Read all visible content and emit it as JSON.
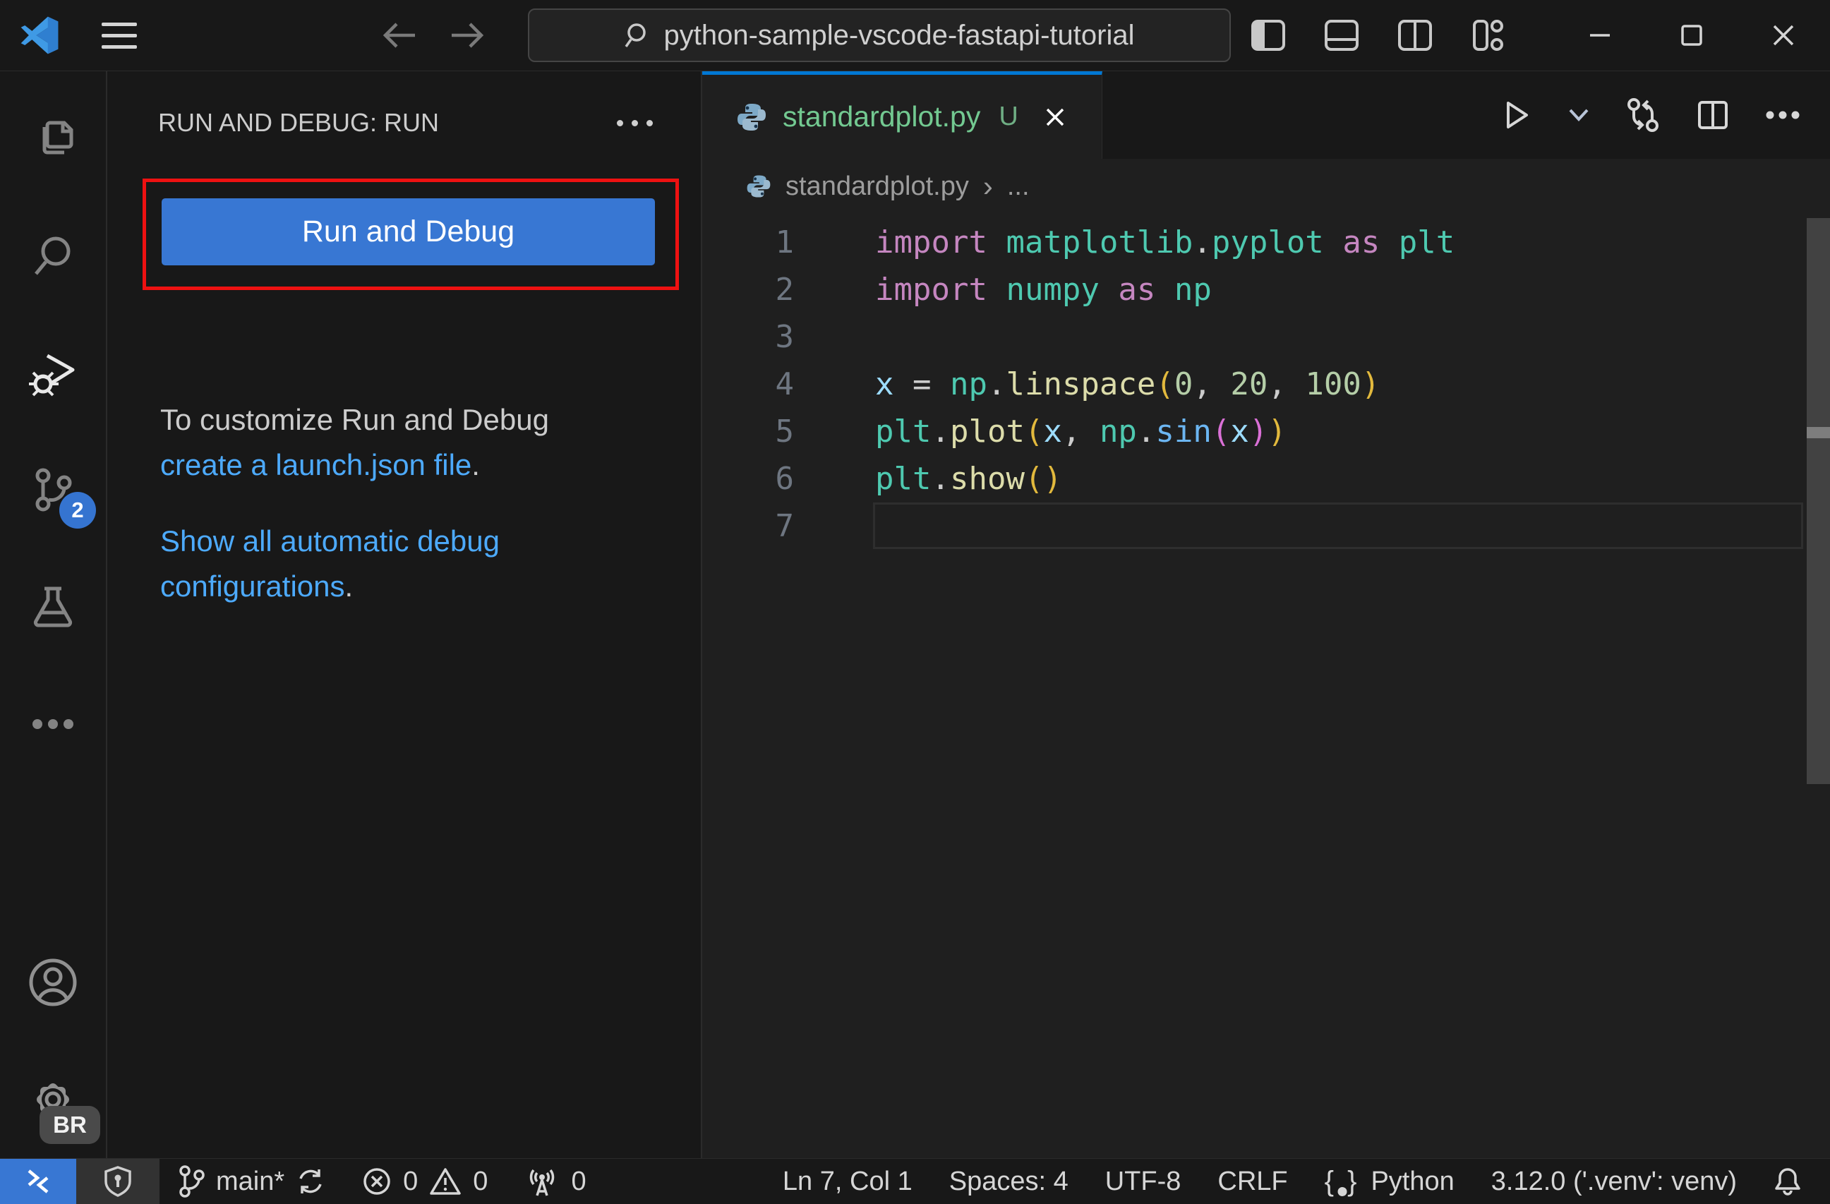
{
  "colors": {
    "accent": "#0078d4",
    "button-blue": "#3877d3",
    "link-blue": "#4daafc",
    "git-green": "#73c991",
    "badge-blue": "#3574d0",
    "annotation-red": "#ee1111",
    "remote-blue": "#3877d3"
  },
  "title_bar": {
    "search_value": "python-sample-vscode-fastapi-tutorial"
  },
  "activity_bar": {
    "source_control_badge": "2",
    "gear_badge": "BR"
  },
  "sidebar": {
    "header": "RUN AND DEBUG: RUN",
    "run_button_label": "Run and Debug",
    "hint_line1": "To customize Run and Debug",
    "hint_link1": "create a launch.json file",
    "hint_period1": ".",
    "hint_link2": "Show all automatic debug configurations",
    "hint_period2": "."
  },
  "editor": {
    "tab": {
      "label": "standardplot.py",
      "dirty_indicator": "U"
    },
    "breadcrumb": {
      "file": "standardplot.py",
      "more": "..."
    },
    "token_colors": {
      "kw": "#C586C0",
      "mod": "#4EC9B0",
      "fn": "#DCDCAA",
      "var": "#9CDCFE",
      "num": "#B5CEA8",
      "op": "#CCCCCC",
      "b1": "#E2B93D",
      "b2": "#DA70D6",
      "fnb": "#6CB6F2"
    },
    "code_lines": [
      {
        "num": "1",
        "tokens": [
          [
            "kw",
            "import"
          ],
          [
            "op",
            " "
          ],
          [
            "mod",
            "matplotlib"
          ],
          [
            "op",
            "."
          ],
          [
            "mod",
            "pyplot"
          ],
          [
            "op",
            " "
          ],
          [
            "kw",
            "as"
          ],
          [
            "op",
            " "
          ],
          [
            "mod",
            "plt"
          ]
        ]
      },
      {
        "num": "2",
        "tokens": [
          [
            "kw",
            "import"
          ],
          [
            "op",
            " "
          ],
          [
            "mod",
            "numpy"
          ],
          [
            "op",
            " "
          ],
          [
            "kw",
            "as"
          ],
          [
            "op",
            " "
          ],
          [
            "mod",
            "np"
          ]
        ]
      },
      {
        "num": "3",
        "tokens": []
      },
      {
        "num": "4",
        "tokens": [
          [
            "var",
            "x"
          ],
          [
            "op",
            " = "
          ],
          [
            "mod",
            "np"
          ],
          [
            "op",
            "."
          ],
          [
            "fn",
            "linspace"
          ],
          [
            "b1",
            "("
          ],
          [
            "num",
            "0"
          ],
          [
            "op",
            ", "
          ],
          [
            "num",
            "20"
          ],
          [
            "op",
            ", "
          ],
          [
            "num",
            "100"
          ],
          [
            "b1",
            ")"
          ]
        ]
      },
      {
        "num": "5",
        "tokens": [
          [
            "mod",
            "plt"
          ],
          [
            "op",
            "."
          ],
          [
            "fn",
            "plot"
          ],
          [
            "b1",
            "("
          ],
          [
            "var",
            "x"
          ],
          [
            "op",
            ", "
          ],
          [
            "mod",
            "np"
          ],
          [
            "op",
            "."
          ],
          [
            "fnb",
            "sin"
          ],
          [
            "b2",
            "("
          ],
          [
            "var",
            "x"
          ],
          [
            "b2",
            ")"
          ],
          [
            "b1",
            ")"
          ]
        ]
      },
      {
        "num": "6",
        "tokens": [
          [
            "mod",
            "plt"
          ],
          [
            "op",
            "."
          ],
          [
            "fn",
            "show"
          ],
          [
            "b1",
            "("
          ],
          [
            "b1",
            ")"
          ]
        ]
      },
      {
        "num": "7",
        "tokens": [],
        "current": true
      }
    ]
  },
  "status_bar": {
    "branch": "main*",
    "errors": "0",
    "warnings": "0",
    "ports": "0",
    "cursor_position": "Ln 7, Col 1",
    "indentation": "Spaces: 4",
    "encoding": "UTF-8",
    "eol": "CRLF",
    "language": "Python",
    "interpreter": "3.12.0 ('.venv': venv)"
  }
}
